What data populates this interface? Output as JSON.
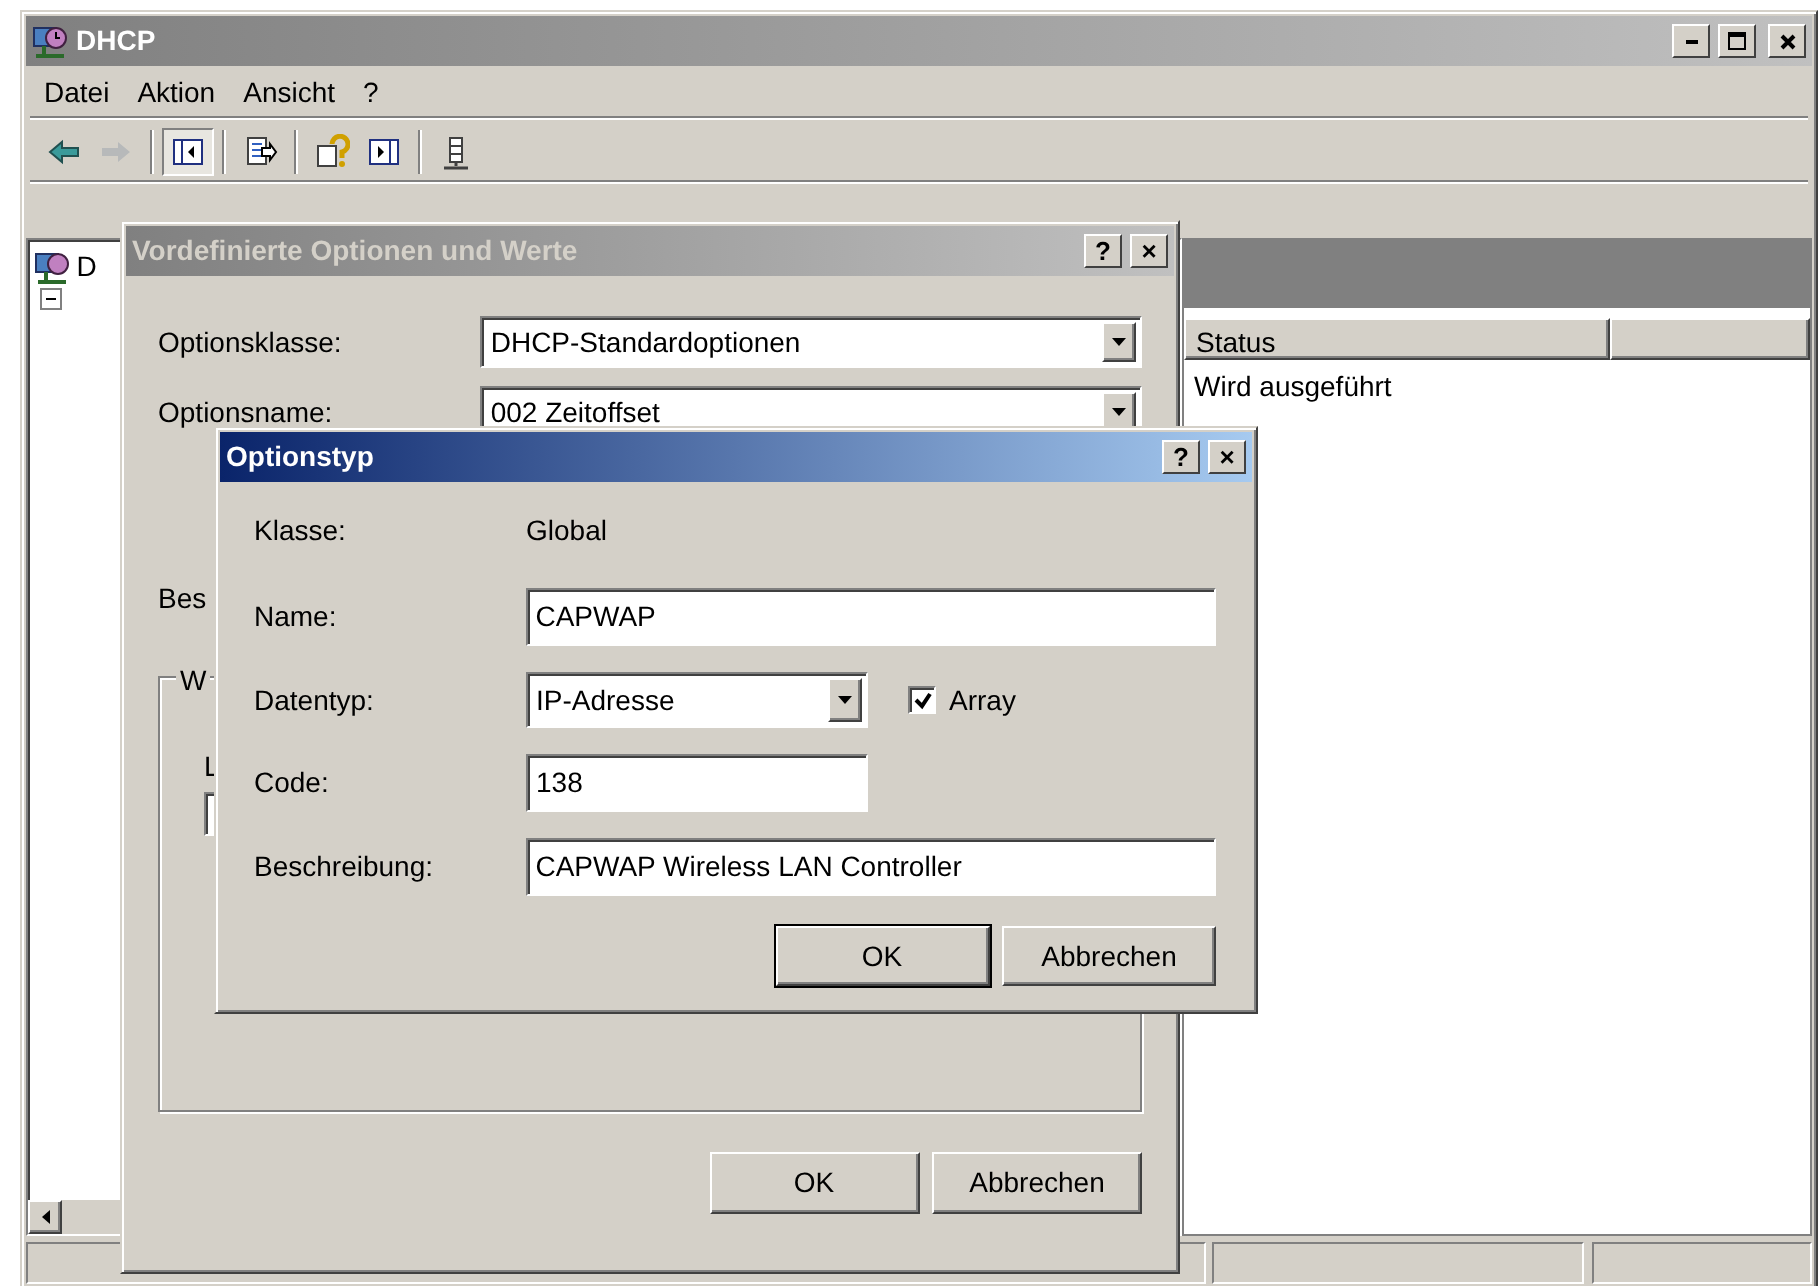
{
  "window": {
    "title": "DHCP",
    "active": false
  },
  "menu": [
    "Datei",
    "Aktion",
    "Ansicht",
    "?"
  ],
  "toolbar": [
    {
      "kind": "back",
      "disabled": false,
      "pressed": false
    },
    {
      "kind": "forward",
      "disabled": true,
      "pressed": false
    },
    {
      "kind": "separator"
    },
    {
      "kind": "tree-toggle",
      "disabled": false,
      "pressed": true
    },
    {
      "kind": "separator"
    },
    {
      "kind": "export",
      "disabled": false,
      "pressed": false
    },
    {
      "kind": "separator"
    },
    {
      "kind": "help",
      "disabled": false,
      "pressed": false
    },
    {
      "kind": "pane",
      "disabled": false,
      "pressed": false
    },
    {
      "kind": "separator"
    },
    {
      "kind": "server",
      "disabled": false,
      "pressed": false
    }
  ],
  "tree": [
    {
      "label": "D",
      "children": [
        {
          "expanded": true
        }
      ]
    }
  ],
  "list": {
    "columns": [
      "Status"
    ],
    "rows": [
      [
        "Wird ausgeführt"
      ]
    ]
  },
  "options_dialog": {
    "title": "Vordefinierte Optionen und Werte",
    "active": false,
    "title_buttons": [
      "?",
      "×"
    ],
    "class_label": "Optionsklasse:",
    "class_value": "DHCP-Standardoptionen",
    "name_label": "Optionsname:",
    "name_value": "002 Zeitoffset",
    "description_label": "Bes",
    "group_label": "W",
    "value_label": "L",
    "buttons": [
      {
        "label": "OK",
        "default": false
      },
      {
        "label": "Abbrechen",
        "default": false
      }
    ]
  },
  "option_type_dialog": {
    "title": "Optionstyp",
    "active": true,
    "title_buttons": [
      "?",
      "×"
    ],
    "class_label": "Klasse:",
    "class_value": "Global",
    "fields": [
      {
        "kind": "text",
        "label": "Name:",
        "value": "CAPWAP"
      },
      {
        "kind": "combo",
        "label": "Datentyp:",
        "value": "IP-Adresse",
        "checkbox": {
          "label": "Array",
          "checked": true
        }
      },
      {
        "kind": "short-text",
        "label": "Code:",
        "value": "138"
      },
      {
        "kind": "text",
        "label": "Beschreibung:",
        "value": "CAPWAP Wireless LAN Controller"
      }
    ],
    "buttons": [
      {
        "label": "OK",
        "default": true
      },
      {
        "label": "Abbrechen",
        "default": false
      }
    ]
  }
}
